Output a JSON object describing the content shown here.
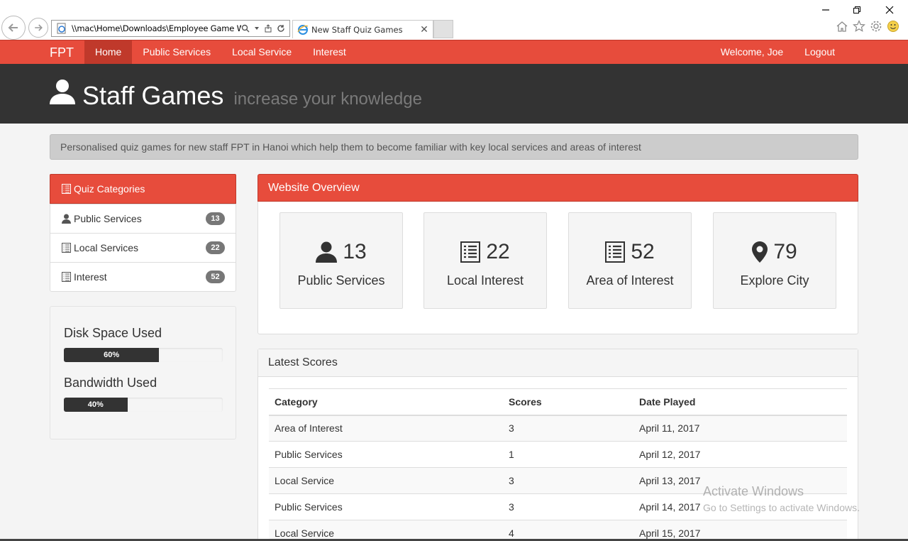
{
  "browser": {
    "address_url": "\\\\mac\\Home\\Downloads\\Employee Game W",
    "tab_title": "New Staff Quiz Games"
  },
  "navbar": {
    "brand": "FPT",
    "links": [
      "Home",
      "Public Services",
      "Local Service",
      "Interest"
    ],
    "welcome": "Welcome, Joe",
    "logout": "Logout"
  },
  "header": {
    "title": "Staff Games",
    "subtitle": "increase your knowledge"
  },
  "intro_text": "Personalised quiz games for new staff FPT in Hanoi which help them to become familiar with key local services and areas of interest",
  "sidebar": {
    "heading": "Quiz Categories",
    "items": [
      {
        "label": "Public Services",
        "count": "13",
        "icon": "user-icon"
      },
      {
        "label": "Local Services",
        "count": "22",
        "icon": "list-icon"
      },
      {
        "label": "Interest",
        "count": "52",
        "icon": "list-icon"
      }
    ],
    "disk_label": "Disk Space Used",
    "disk_percent": 60,
    "disk_text": "60%",
    "bandwidth_label": "Bandwidth Used",
    "bandwidth_percent": 40,
    "bandwidth_text": "40%"
  },
  "overview": {
    "heading": "Website Overview",
    "tiles": [
      {
        "number": "13",
        "label": "Public Services",
        "icon": "user-icon"
      },
      {
        "number": "22",
        "label": "Local Interest",
        "icon": "list-icon"
      },
      {
        "number": "52",
        "label": "Area of Interest",
        "icon": "list-icon"
      },
      {
        "number": "79",
        "label": "Explore City",
        "icon": "map-marker-icon"
      }
    ]
  },
  "scores": {
    "heading": "Latest Scores",
    "columns": [
      "Category",
      "Scores",
      "Date Played"
    ],
    "rows": [
      [
        "Area of Interest",
        "3",
        "April 11, 2017"
      ],
      [
        "Public Services",
        "1",
        "April 12, 2017"
      ],
      [
        "Local Service",
        "3",
        "April 13, 2017"
      ],
      [
        "Public Services",
        "3",
        "April 14, 2017"
      ],
      [
        "Local Service",
        "4",
        "April 15, 2017"
      ]
    ]
  },
  "watermark": {
    "line1": "Activate Windows",
    "line2": "Go to Settings to activate Windows."
  },
  "colors": {
    "accent": "#e74c3c",
    "accent_dark": "#c0392b",
    "header_bg": "#333333"
  }
}
